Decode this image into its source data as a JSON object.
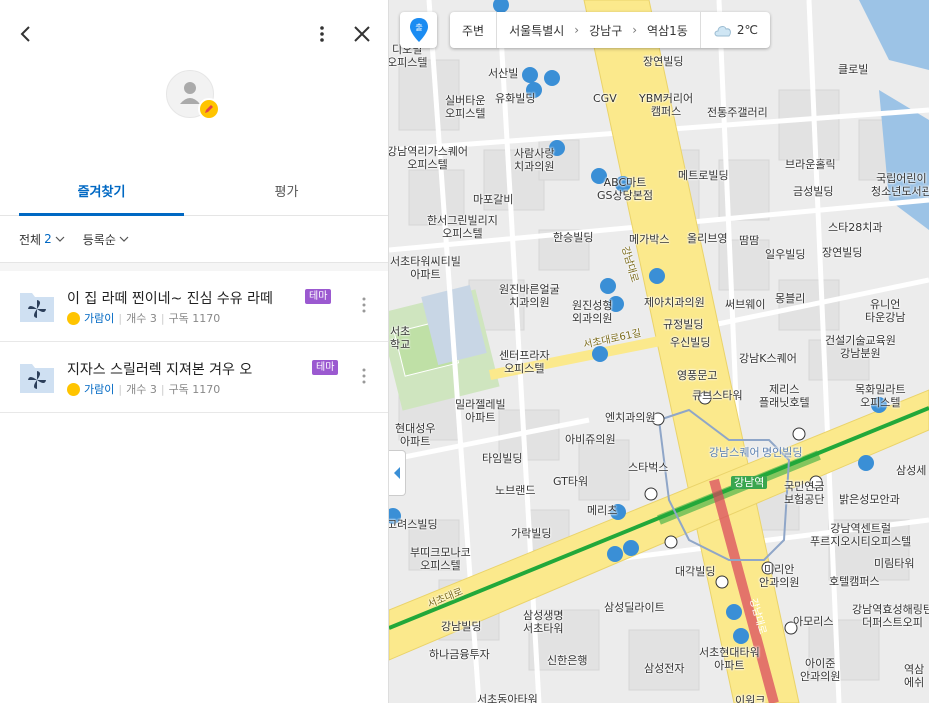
{
  "panel": {
    "tabs": [
      {
        "label": "즐겨찾기",
        "active": true
      },
      {
        "label": "평가",
        "active": false
      }
    ],
    "filters": {
      "scope_label": "전체",
      "scope_count": "2",
      "sort_label": "등록순"
    },
    "items": [
      {
        "title": "이 집 라떼 찐이네~ 진심 수유 라떼",
        "tag": "테마",
        "owner": "가람이",
        "places": "개수 3",
        "saves": "구독 1170"
      },
      {
        "title": "지자스 스릴러렉 지져본 겨우 오",
        "tag": "테마",
        "owner": "가람이",
        "places": "개수 3",
        "saves": "구독 1170"
      }
    ]
  },
  "mapbar": {
    "nearby_label": "주변",
    "breadcrumb": [
      "서울특별시",
      "강남구",
      "역삼1동"
    ],
    "weather_temp": "2℃"
  },
  "map": {
    "pois": [
      {
        "text": "출",
        "name": "poi-top-1"
      },
      {
        "text": "디오빌\n오피스텔"
      },
      {
        "text": "장연빌딩"
      },
      {
        "text": "클로빌"
      },
      {
        "text": "서산빌"
      },
      {
        "text": "유화빌딩"
      },
      {
        "text": "CGV"
      },
      {
        "text": "YBM커리어\n캠퍼스"
      },
      {
        "text": "실버타운\n오피스텔"
      },
      {
        "text": "전통주갤러리"
      },
      {
        "text": "강남역리가스퀘어\n오피스텔"
      },
      {
        "text": "사람사랑\n치과의원"
      },
      {
        "text": "ABC마트\nGS상당본점"
      },
      {
        "text": "브라운홀릭"
      },
      {
        "text": "국립어린이\n청소년도서관"
      },
      {
        "text": "마포갈비"
      },
      {
        "text": "메트로빌딩"
      },
      {
        "text": "금성빌딩"
      },
      {
        "text": "한서그린빌리지\n오피스텔"
      },
      {
        "text": "한승빌딩"
      },
      {
        "text": "메가박스"
      },
      {
        "text": "올리브영"
      },
      {
        "text": "땀땀"
      },
      {
        "text": "일우빌딩"
      },
      {
        "text": "스타28치과"
      },
      {
        "text": "장연빌딩"
      },
      {
        "text": "서초타워씨티빌\n아파트"
      },
      {
        "text": "원진바른얼굴\n치과의원"
      },
      {
        "text": "원진성형\n외과의원"
      },
      {
        "text": "제아치과의원"
      },
      {
        "text": "써브웨이"
      },
      {
        "text": "몽블리"
      },
      {
        "text": "유니언\n타운강남"
      },
      {
        "text": "서초\n학교"
      },
      {
        "text": "규정빌딩"
      },
      {
        "text": "우신빌딩"
      },
      {
        "text": "건설기술교육원\n강남분원"
      },
      {
        "text": "센터프라자\n오피스텔"
      },
      {
        "text": "영풍문고"
      },
      {
        "text": "강남K스퀘어"
      },
      {
        "text": "제리스\n플래닛호텔"
      },
      {
        "text": "목화밀라트\n오피스텔"
      },
      {
        "text": "밀라젤레빌\n아파트"
      },
      {
        "text": "엔치과의원"
      },
      {
        "text": "큐브스타워"
      },
      {
        "text": "현대성우\n아파트"
      },
      {
        "text": "아비쥬의원"
      },
      {
        "text": "타임빌딩"
      },
      {
        "text": "스타벅스"
      },
      {
        "text": "강남스퀘어"
      },
      {
        "text": "명인빌딩"
      },
      {
        "text": "삼성세"
      },
      {
        "text": "노브랜드"
      },
      {
        "text": "GT타워"
      },
      {
        "text": "강남역"
      },
      {
        "text": "국민연금\n보험공단"
      },
      {
        "text": "밝은성모안과"
      },
      {
        "text": "메리츠"
      },
      {
        "text": "고려스빌딩"
      },
      {
        "text": "가락빌딩"
      },
      {
        "text": "부띠크모나코\n오피스텔"
      },
      {
        "text": "강남역센트럴\n푸르지오시티오피스텔"
      },
      {
        "text": "대각빌딩"
      },
      {
        "text": "미리안\n안과의원"
      },
      {
        "text": "미림타워"
      },
      {
        "text": "호텔캠퍼스"
      },
      {
        "text": "삼성생명\n서초타워"
      },
      {
        "text": "삼성딜라이트"
      },
      {
        "text": "강남빌딩"
      },
      {
        "text": "아모리스"
      },
      {
        "text": "강남역효성해링턴\n더퍼스트오피"
      },
      {
        "text": "하나금융투자"
      },
      {
        "text": "신한은행"
      },
      {
        "text": "서초현대타워\n아파트"
      },
      {
        "text": "삼성전자"
      },
      {
        "text": "아이준\n안과의원"
      },
      {
        "text": "서초동아타워"
      },
      {
        "text": "이워크"
      },
      {
        "text": "역삼\n에쉬"
      },
      {
        "text": "강남대로",
        "name": "road-label-gangnam-daero"
      },
      {
        "text": "서초대로",
        "name": "road-label-seocho-daero"
      },
      {
        "text": "서초대로61길",
        "name": "road-label-seocho-61"
      },
      {
        "text": "강남대로",
        "name": "road-label-gangnam-daero-v"
      }
    ]
  },
  "colors": {
    "accent": "#0068c3",
    "tag": "#9b59d0",
    "coin": "#ffc400",
    "main_road": "#fbe98c",
    "subway_green": "#22a83a",
    "subway_red": "#d9435d",
    "bus_blue": "#3a8fd6"
  },
  "icons": {
    "back": "chevron-left-icon",
    "more": "more-vertical-icon",
    "close": "close-icon",
    "folder": "pinwheel-folder-icon",
    "pin": "location-pin-icon",
    "weather": "cloud-icon"
  }
}
